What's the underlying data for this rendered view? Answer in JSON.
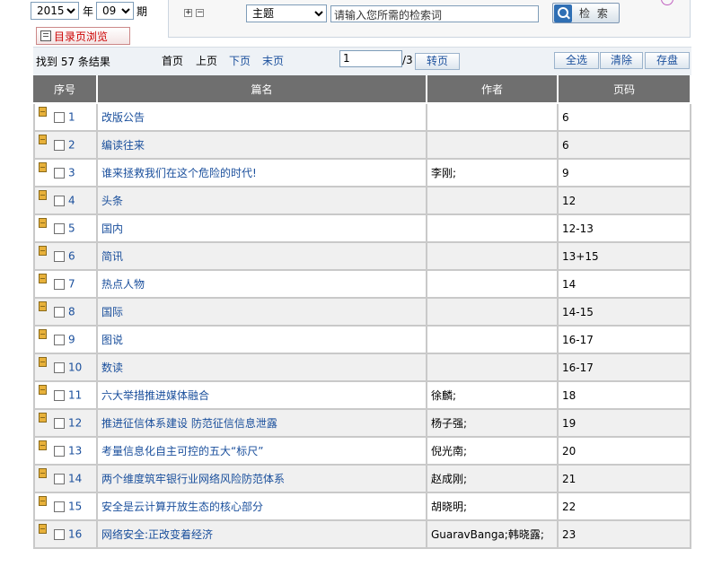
{
  "filters": {
    "year": "2015",
    "year_label": "年",
    "issue": "09",
    "issue_label": "期",
    "catalog_button": "目录页浏览"
  },
  "search": {
    "field": "主题",
    "query": "请输入您所需的检索词",
    "button": "检 索",
    "expand_plus": "+",
    "expand_minus": "−"
  },
  "toolbar": {
    "result_text": "找到 57 条结果",
    "first": "首页",
    "prev": "上页",
    "next": "下页",
    "last": "末页",
    "page_value": "1",
    "page_total": "/3",
    "goto": "转页",
    "select_all": "全选",
    "clear": "清除",
    "save": "存盘"
  },
  "table": {
    "headers": [
      "序号",
      "篇名",
      "作者",
      "页码"
    ],
    "rows": [
      {
        "no": "1",
        "title": "改版公告",
        "author": "",
        "pages": "6"
      },
      {
        "no": "2",
        "title": "编读往来",
        "author": "",
        "pages": "6"
      },
      {
        "no": "3",
        "title": "谁来拯救我们在这个危险的时代!",
        "author": "李刚;",
        "pages": "9"
      },
      {
        "no": "4",
        "title": "头条",
        "author": "",
        "pages": "12"
      },
      {
        "no": "5",
        "title": "国内",
        "author": "",
        "pages": "12-13"
      },
      {
        "no": "6",
        "title": "简讯",
        "author": "",
        "pages": "13+15"
      },
      {
        "no": "7",
        "title": "热点人物",
        "author": "",
        "pages": "14"
      },
      {
        "no": "8",
        "title": "国际",
        "author": "",
        "pages": "14-15"
      },
      {
        "no": "9",
        "title": "图说",
        "author": "",
        "pages": "16-17"
      },
      {
        "no": "10",
        "title": "数读",
        "author": "",
        "pages": "16-17"
      },
      {
        "no": "11",
        "title": "六大举措推进媒体融合",
        "author": "徐麟;",
        "pages": "18"
      },
      {
        "no": "12",
        "title": "推进征信体系建设 防范征信信息泄露",
        "author": "杨子强;",
        "pages": "19"
      },
      {
        "no": "13",
        "title": "考量信息化自主可控的五大“标尺”",
        "author": "倪光南;",
        "pages": "20"
      },
      {
        "no": "14",
        "title": "两个维度筑牢银行业网络风险防范体系",
        "author": "赵成刚;",
        "pages": "21"
      },
      {
        "no": "15",
        "title": "安全是云计算开放生态的核心部分",
        "author": "胡晓明;",
        "pages": "22"
      },
      {
        "no": "16",
        "title": "网络安全:正改变着经济",
        "author": "GuaravBanga;韩晓露;",
        "pages": "23"
      }
    ]
  }
}
